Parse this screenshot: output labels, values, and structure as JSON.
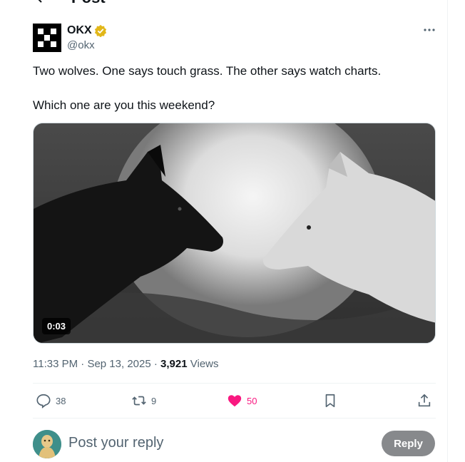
{
  "header": {
    "title": "Post"
  },
  "author": {
    "name": "OKX",
    "handle": "@okx",
    "verified": true,
    "badge_color": "#e2b719"
  },
  "tweet": {
    "lines": [
      "Two wolves. One says touch grass. The other says watch charts.",
      "Which one are you this weekend?"
    ]
  },
  "media": {
    "duration": "0:03",
    "type": "video"
  },
  "meta": {
    "time": "11:33 PM",
    "date": "Sep 13, 2025",
    "views_count": "3,921",
    "views_label": "Views"
  },
  "actions": {
    "replies": "38",
    "reposts": "9",
    "likes": "50",
    "liked": true
  },
  "reply": {
    "placeholder": "Post your reply",
    "button_label": "Reply"
  },
  "colors": {
    "like": "#f91880",
    "muted": "#536471",
    "reply_button": "#87898c"
  }
}
